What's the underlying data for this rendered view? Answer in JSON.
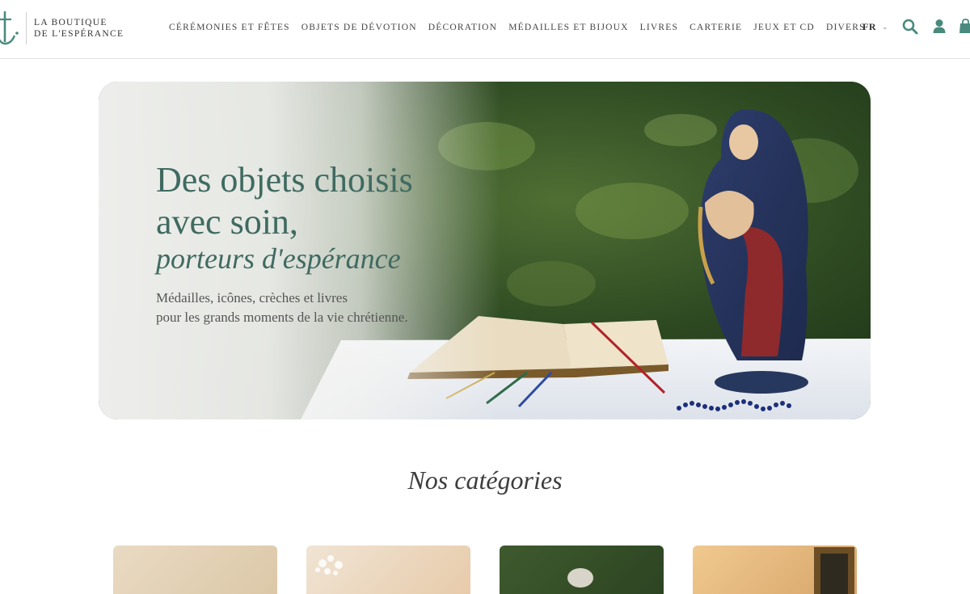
{
  "brand": {
    "line1": "LA BOUTIQUE",
    "line2": "DE L'ESPÉRANCE",
    "logo_icon": "anchor-cross-icon",
    "accent": "#4a8a7e"
  },
  "nav": {
    "items": [
      "CÉRÉMONIES ET FÊTES",
      "OBJETS DE DÉVOTION",
      "DÉCORATION",
      "MÉDAILLES ET BIJOUX",
      "LIVRES",
      "CARTERIE",
      "JEUX ET CD",
      "DIVERS"
    ]
  },
  "header_actions": {
    "language": "FR",
    "icons": [
      "search-icon",
      "account-icon",
      "cart-icon"
    ]
  },
  "hero": {
    "title_line1": "Des objets choisis",
    "title_line2": "avec soin,",
    "title_italic": "porteurs d'espérance",
    "subtitle_line1": "Médailles, icônes, crèches et livres",
    "subtitle_line2": "pour les grands moments de la vie chrétienne.",
    "title_color": "#3f6a61"
  },
  "categories": {
    "heading": "Nos catégories",
    "cards": [
      "category-card-1",
      "category-card-2",
      "category-card-3",
      "category-card-4"
    ]
  }
}
